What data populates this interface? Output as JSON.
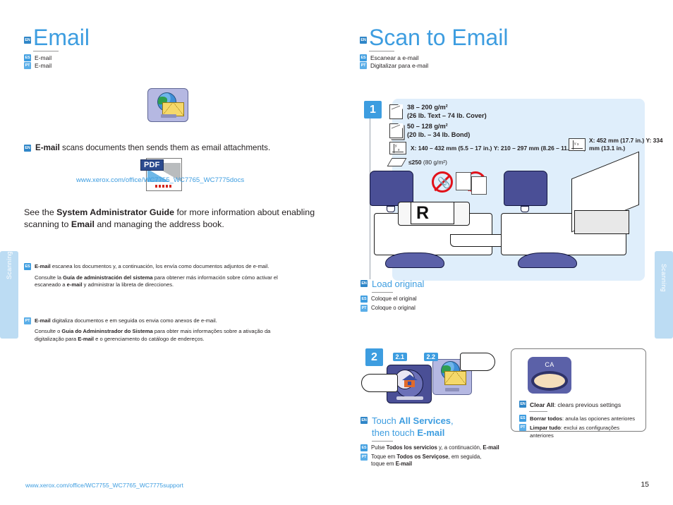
{
  "side_tabs": {
    "left_label": "Scanning",
    "right_label": "Scanning"
  },
  "left": {
    "title": "Email",
    "title_badge": "EN",
    "subtitles": [
      {
        "badge": "ES",
        "text": "E-mail"
      },
      {
        "badge": "PT",
        "text": "E-mail"
      }
    ],
    "icon_name": "email-app-icon",
    "intro": {
      "badge": "EN",
      "bold": "E-mail",
      "rest": " scans documents then sends them as email attachments."
    },
    "pdf_tag": "PDF",
    "docs_url": "www.xerox.com/office/WC7755_WC7765_WC7775docs",
    "see_note": {
      "p1": "See the ",
      "b1": "System Administrator Guide",
      "p2": " for more information about enabling scanning to ",
      "b2": "Email",
      "p3": " and managing the address book."
    },
    "es_block": {
      "badge": "ES",
      "lead_bold": "E-mail",
      "lead_rest": " escanea los documentos y, a continuación, los envía como documentos adjuntos de e-mail.",
      "body_p1": "Consulte la ",
      "body_b1": "Guía de administración del sistema",
      "body_p2": " para obtener más información sobre cómo activar el escaneado a ",
      "body_b2": "e-mail",
      "body_p3": " y administrar la libreta de direcciones."
    },
    "pt_block": {
      "badge": "PT",
      "lead_bold": "E-mail",
      "lead_rest": " digitaliza documentos e em seguida os envia como anexos de e-mail.",
      "body_p1": "Consulte o ",
      "body_b1": "Guia do Admininstrador do Sistema",
      "body_p2": " para obter mais informações sobre a ativação da digitalização para ",
      "body_b2": "E-mail",
      "body_p3": " e o gerenciamento do catálogo de endereços."
    }
  },
  "right": {
    "title": "Scan to Email",
    "title_badge": "EN",
    "subtitles": [
      {
        "badge": "ES",
        "text": "Escanear a e-mail"
      },
      {
        "badge": "PT",
        "text": "Digitalizar para e-mail"
      }
    ],
    "step1": {
      "number": "1",
      "specs": {
        "weight1_line1": "38 – 200 g/m²",
        "weight1_line2": "(26 lb. Text – 74 lb. Cover)",
        "weight2_line1": "50 – 128 g/m²",
        "weight2_line2": "(20 lb. – 34 lb. Bond)",
        "size_x": "X: 140 – 432 mm (5.5 – 17 in.)",
        "size_y": "Y: 210 – 297 mm (8.26 – 11.69 in.)",
        "capacity_bold": "≤250",
        "capacity_rest": " (80 g/m²)"
      },
      "glass": {
        "x": "X: 452 mm (17.7 in.)",
        "y": "Y: 334 mm (13.1 in.)"
      },
      "caption_en": {
        "badge": "EN",
        "text": "Load original"
      },
      "caption_es": {
        "badge": "ES",
        "text": "Coloque el original"
      },
      "caption_pt": {
        "badge": "PT",
        "text": "Coloque o original"
      }
    },
    "step2": {
      "number": "2",
      "marker_1": "2.1",
      "marker_2": "2.2",
      "caption_en": {
        "badge": "EN",
        "p1": "Touch ",
        "b1": "All Services",
        "p2": ",",
        "line2_p1": "then touch ",
        "line2_b1": "E-mail"
      },
      "caption_es": {
        "badge": "ES",
        "p1": "Pulse ",
        "b1": "Todos los servicios",
        "p2": " y, a continuación, ",
        "b2": "E-mail"
      },
      "caption_pt": {
        "badge": "PT",
        "p1": "Toque em ",
        "b1": "Todos os Serviçose",
        "p2": ", em seguida,",
        "line2_p1": "toque em ",
        "line2_b1": "E-mail"
      },
      "clear_all": {
        "button_label": "CA",
        "en": {
          "badge": "EN",
          "bold": "Clear All",
          "rest": ": clears previous settings"
        },
        "es": {
          "badge": "ES",
          "bold": "Borrar todos",
          "rest": ": anula las opciones anteriores"
        },
        "pt": {
          "badge": "PT",
          "bold": "Limpar tudo",
          "rest": ": exclui as configurações anteriores"
        }
      }
    }
  },
  "footer": {
    "url": "www.xerox.com/office/WC7755_WC7765_WC7775support",
    "page": "15"
  }
}
